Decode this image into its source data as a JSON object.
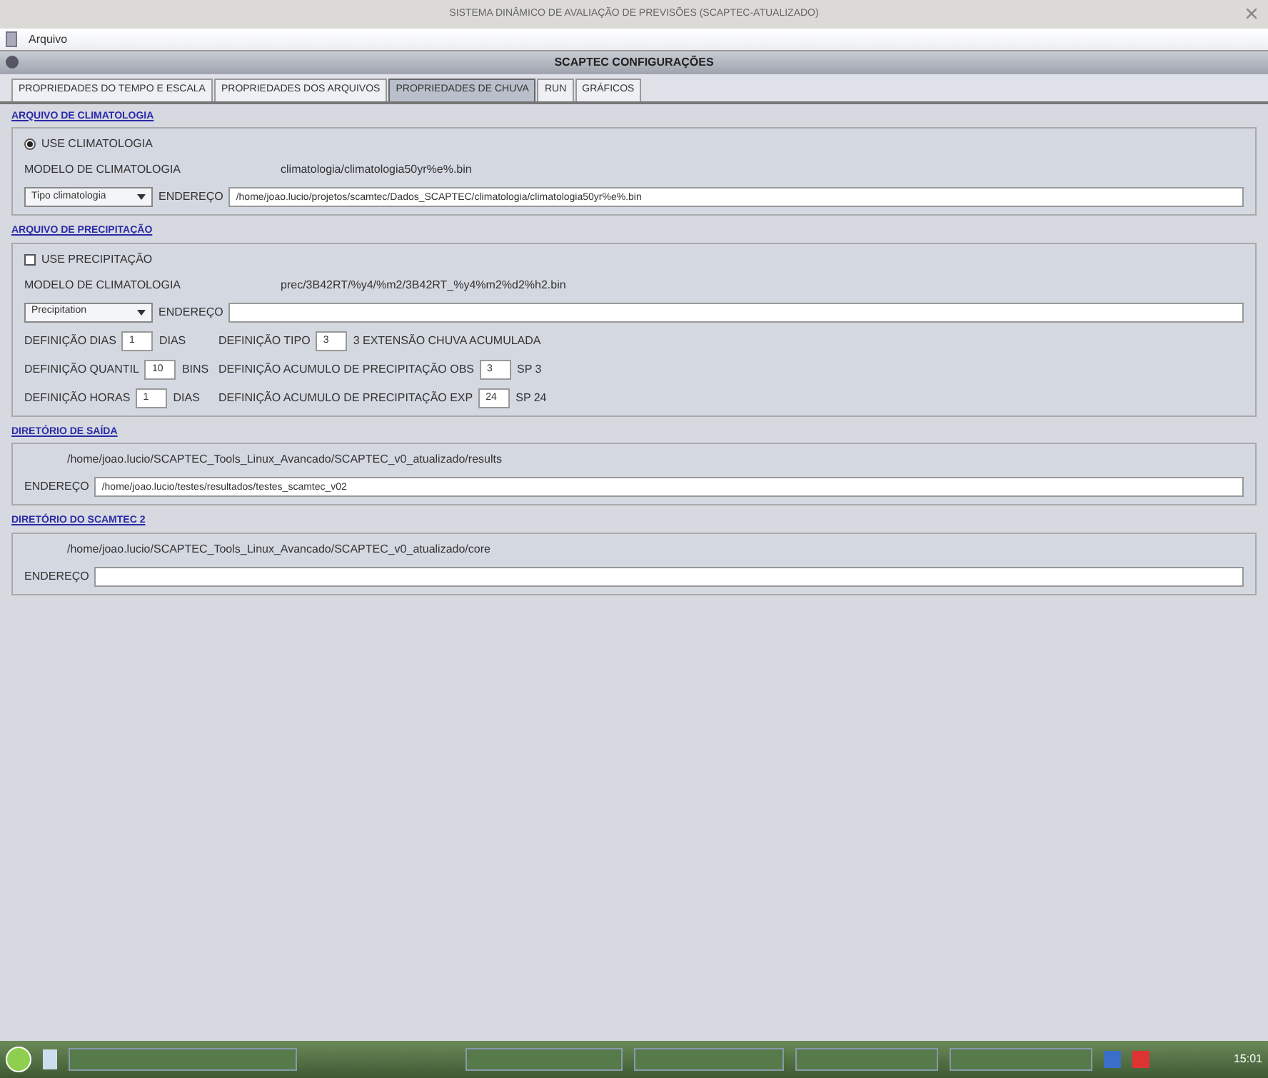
{
  "window": {
    "title": "SISTEMA DINÂMICO DE AVALIAÇÃO DE PREVISÕES (SCAPTEC-ATUALIZADO)"
  },
  "menu": [
    "Arquivo"
  ],
  "dialog": {
    "title": "SCAPTEC CONFIGURAÇÕES"
  },
  "tabs": [
    {
      "label": "PROPRIEDADES DO TEMPO E ESCALA",
      "selected": false
    },
    {
      "label": "PROPRIEDADES DOS ARQUIVOS",
      "selected": false
    },
    {
      "label": "PROPRIEDADES DE CHUVA",
      "selected": true
    },
    {
      "label": "RUN",
      "selected": false
    },
    {
      "label": "GRÁFICOS",
      "selected": false
    }
  ],
  "climatology": {
    "title": "ARQUIVO DE CLIMATOLOGIA",
    "option": {
      "label": "USE CLIMATOLOGIA",
      "selected": true
    },
    "model_label": "MODELO DE CLIMATOLOGIA",
    "model_value": "climatologia/climatologia50yr%e%.bin",
    "dropdown": "Tipo climatologia",
    "address_label": "ENDEREÇO",
    "address_value": "/home/joao.lucio/projetos/scamtec/Dados_SCAPTEC/climatologia/climatologia50yr%e%.bin"
  },
  "precipitation": {
    "title": "ARQUIVO DE PRECIPITAÇÃO",
    "option": {
      "label": "USE PRECIPITAÇÃO",
      "checked": false
    },
    "model_label": "MODELO DE CLIMATOLOGIA",
    "model_value": "prec/3B42RT/%y4/%m2/3B42RT_%y4%m2%d2%h2.bin",
    "dropdown": "Precipitation",
    "address_label": "ENDEREÇO",
    "rows": [
      [
        {
          "label": "DEFINIÇÃO DIAS",
          "value": "1",
          "unit": "DIAS"
        },
        {
          "label": "DEFINIÇÃO TIPO",
          "value": "3",
          "unit": "3 EXTENSÃO CHUVA ACUMULADA"
        }
      ],
      [
        {
          "label": "DEFINIÇÃO QUANTIL",
          "value": "10",
          "unit": "BINS"
        },
        {
          "label": "DEFINIÇÃO ACUMULO DE PRECIPITAÇÃO OBS",
          "value": "3",
          "unit": "SP 3"
        }
      ],
      [
        {
          "label": "DEFINIÇÃO HORAS",
          "value": "1",
          "unit": "DIAS"
        },
        {
          "label": "DEFINIÇÃO ACUMULO DE PRECIPITAÇÃO EXP",
          "value": "24",
          "unit": "SP 24"
        }
      ]
    ]
  },
  "output": {
    "title": "DIRETÓRIO DE SAÍDA",
    "path": "/home/joao.lucio/SCAPTEC_Tools_Linux_Avancado/SCAPTEC_v0_atualizado/results",
    "address_label": "ENDEREÇO",
    "address_value": "/home/joao.lucio/testes/resultados/testes_scamtec_v02"
  },
  "scripts": {
    "title": "DIRETÓRIO DO SCAMTEC 2",
    "path": "/home/joao.lucio/SCAPTEC_Tools_Linux_Avancado/SCAPTEC_v0_atualizado/core",
    "address_label": "ENDEREÇO"
  },
  "taskbar": {
    "clock": "15:01"
  }
}
